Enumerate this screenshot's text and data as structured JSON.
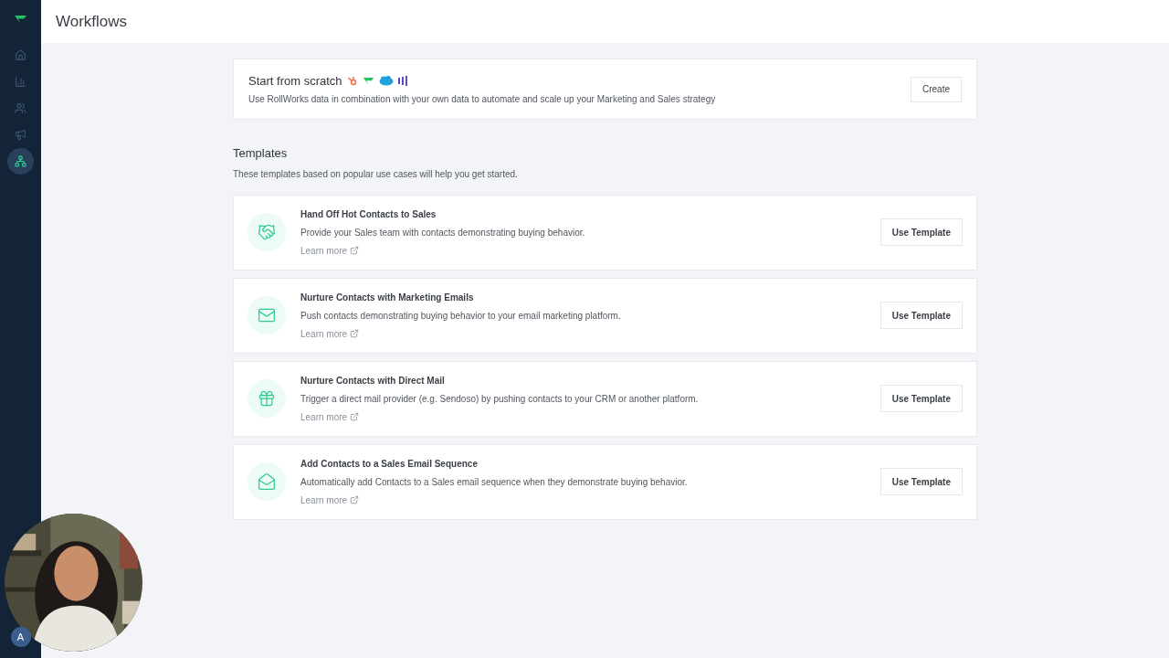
{
  "page_title": "Workflows",
  "sidebar": {
    "items": [
      {
        "kind": "home",
        "selected": false
      },
      {
        "kind": "chart",
        "selected": false
      },
      {
        "kind": "people",
        "selected": false
      },
      {
        "kind": "megaphone",
        "selected": false
      },
      {
        "kind": "workflow",
        "selected": true
      }
    ],
    "avatar": "A"
  },
  "scratch": {
    "title": "Start from scratch",
    "description": "Use RollWorks data in combination with your own data to automate and scale up your Marketing and Sales strategy",
    "button": "Create"
  },
  "templates_section": {
    "title": "Templates",
    "subtitle": "These templates based on popular use cases will help you get started."
  },
  "templates": [
    {
      "kind": "handshake",
      "title": "Hand Off Hot Contacts to Sales",
      "description": "Provide your Sales team with contacts demonstrating buying behavior.",
      "link": "Learn more",
      "button": "Use Template"
    },
    {
      "kind": "mail",
      "title": "Nurture Contacts with Marketing Emails",
      "description": "Push contacts demonstrating buying behavior to your email marketing platform.",
      "link": "Learn more",
      "button": "Use Template"
    },
    {
      "kind": "gift",
      "title": "Nurture Contacts with Direct Mail",
      "description": "Trigger a direct mail provider (e.g. Sendoso) by pushing contacts to your CRM or another platform.",
      "link": "Learn more",
      "button": "Use Template"
    },
    {
      "kind": "mail-open",
      "title": "Add Contacts to a Sales Email Sequence",
      "description": "Automatically add Contacts to a Sales email sequence when they demonstrate buying behavior.",
      "link": "Learn more",
      "button": "Use Template"
    }
  ]
}
